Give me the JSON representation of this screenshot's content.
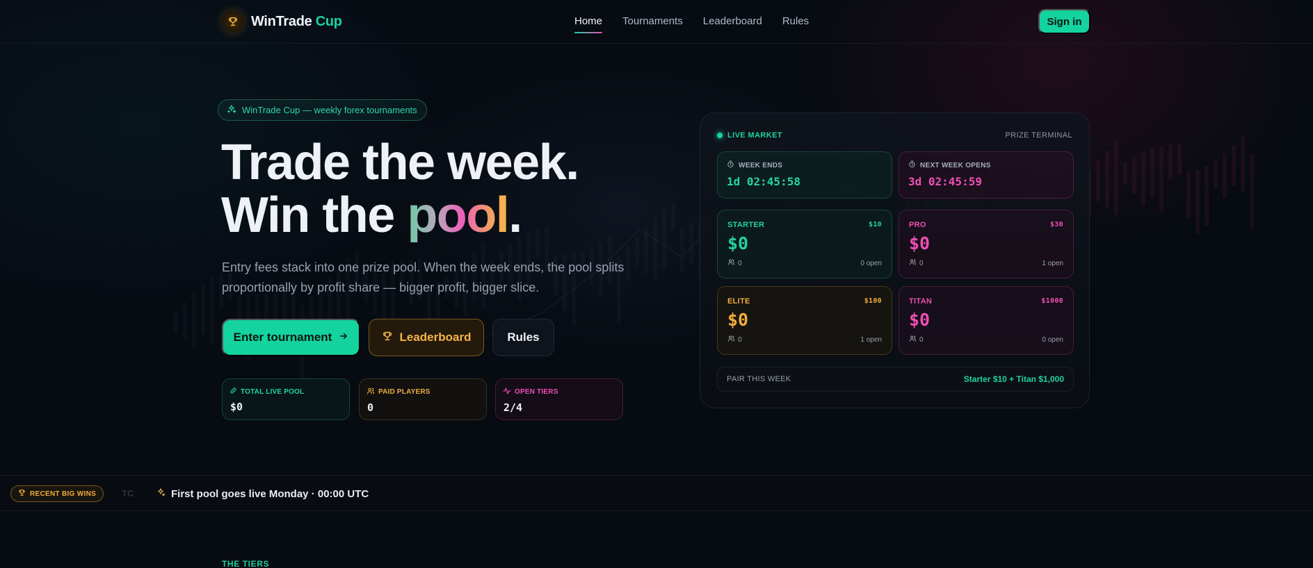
{
  "brand": {
    "name": "WinTrade",
    "accent": "Cup"
  },
  "nav": {
    "links": [
      {
        "label": "Home",
        "active": true
      },
      {
        "label": "Tournaments",
        "active": false
      },
      {
        "label": "Leaderboard",
        "active": false
      },
      {
        "label": "Rules",
        "active": false
      }
    ],
    "signin": "Sign in"
  },
  "hero": {
    "pill": "WinTrade Cup — weekly forex tournaments",
    "line1": "Trade the week.",
    "line2_prefix": "Win the ",
    "line2_highlight": "pool",
    "line2_suffix": ".",
    "lede": "Entry fees stack into one prize pool. When the week ends, the pool splits proportionally by profit share — bigger profit, bigger slice.",
    "buttons": {
      "enter": "Enter tournament",
      "leaderboard": "Leaderboard",
      "rules": "Rules"
    },
    "stats": [
      {
        "label": "TOTAL LIVE POOL",
        "value": "$0",
        "icon": "link-icon"
      },
      {
        "label": "PAID PLAYERS",
        "value": "0",
        "icon": "users-icon"
      },
      {
        "label": "OPEN TIERS",
        "value": "2/4",
        "icon": "pulse-icon"
      }
    ]
  },
  "terminal": {
    "live": "LIVE MARKET",
    "tag": "PRIZE TERMINAL",
    "week_ends": {
      "label": "WEEK ENDS",
      "value": "1d 02:45:58"
    },
    "next_week": {
      "label": "NEXT WEEK OPENS",
      "value": "3d 02:45:59"
    },
    "tiers": [
      {
        "name": "STARTER",
        "fee": "$10",
        "pool": "$0",
        "players": "0",
        "open": "0 open"
      },
      {
        "name": "PRO",
        "fee": "$30",
        "pool": "$0",
        "players": "0",
        "open": "1 open"
      },
      {
        "name": "ELITE",
        "fee": "$100",
        "pool": "$0",
        "players": "0",
        "open": "1 open"
      },
      {
        "name": "TITAN",
        "fee": "$1000",
        "pool": "$0",
        "players": "0",
        "open": "0 open"
      }
    ],
    "pair": {
      "label": "PAIR THIS WEEK",
      "value": "Starter $10 + Titan $1,000"
    }
  },
  "ticker": {
    "badge": "RECENT BIG WINS",
    "ghost": "TC",
    "message": "First pool goes live Monday · 00:00 UTC"
  },
  "next_section": {
    "label": "THE TIERS"
  },
  "colors": {
    "green": "#14d39e",
    "pink": "#ef4fb4",
    "gold": "#f2ad3c",
    "bg": "#070b12"
  }
}
